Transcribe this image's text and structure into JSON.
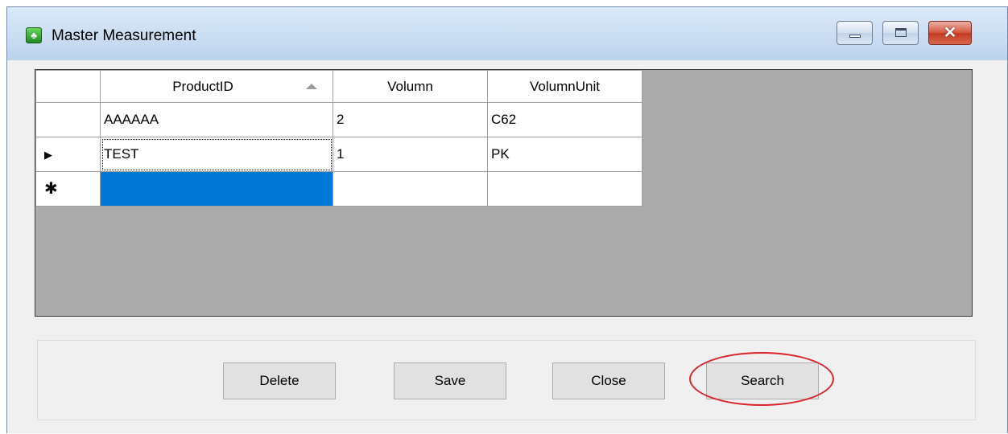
{
  "window": {
    "title": "Master Measurement",
    "icon": "app-leaf-icon"
  },
  "title_controls": {
    "minimize_icon": "minimize-icon",
    "maximize_icon": "maximize-icon",
    "close_icon": "close-icon",
    "close_glyph": "✕"
  },
  "grid": {
    "columns": [
      "ProductID",
      "Volumn",
      "VolumnUnit"
    ],
    "sorted_column": "ProductID",
    "sort_direction": "ascending",
    "rows": [
      {
        "indicator": "",
        "ProductID": "AAAAAA",
        "Volumn": "2",
        "VolumnUnit": "C62"
      },
      {
        "indicator": "▶",
        "ProductID": "TEST",
        "Volumn": "1",
        "VolumnUnit": "PK"
      }
    ],
    "new_row_indicator": "✱",
    "selection_color": "#0078d7"
  },
  "buttons": {
    "delete": "Delete",
    "save": "Save",
    "close": "Close",
    "search": "Search"
  },
  "annotation": {
    "highlighted": "search-button",
    "color": "#d9252b"
  }
}
